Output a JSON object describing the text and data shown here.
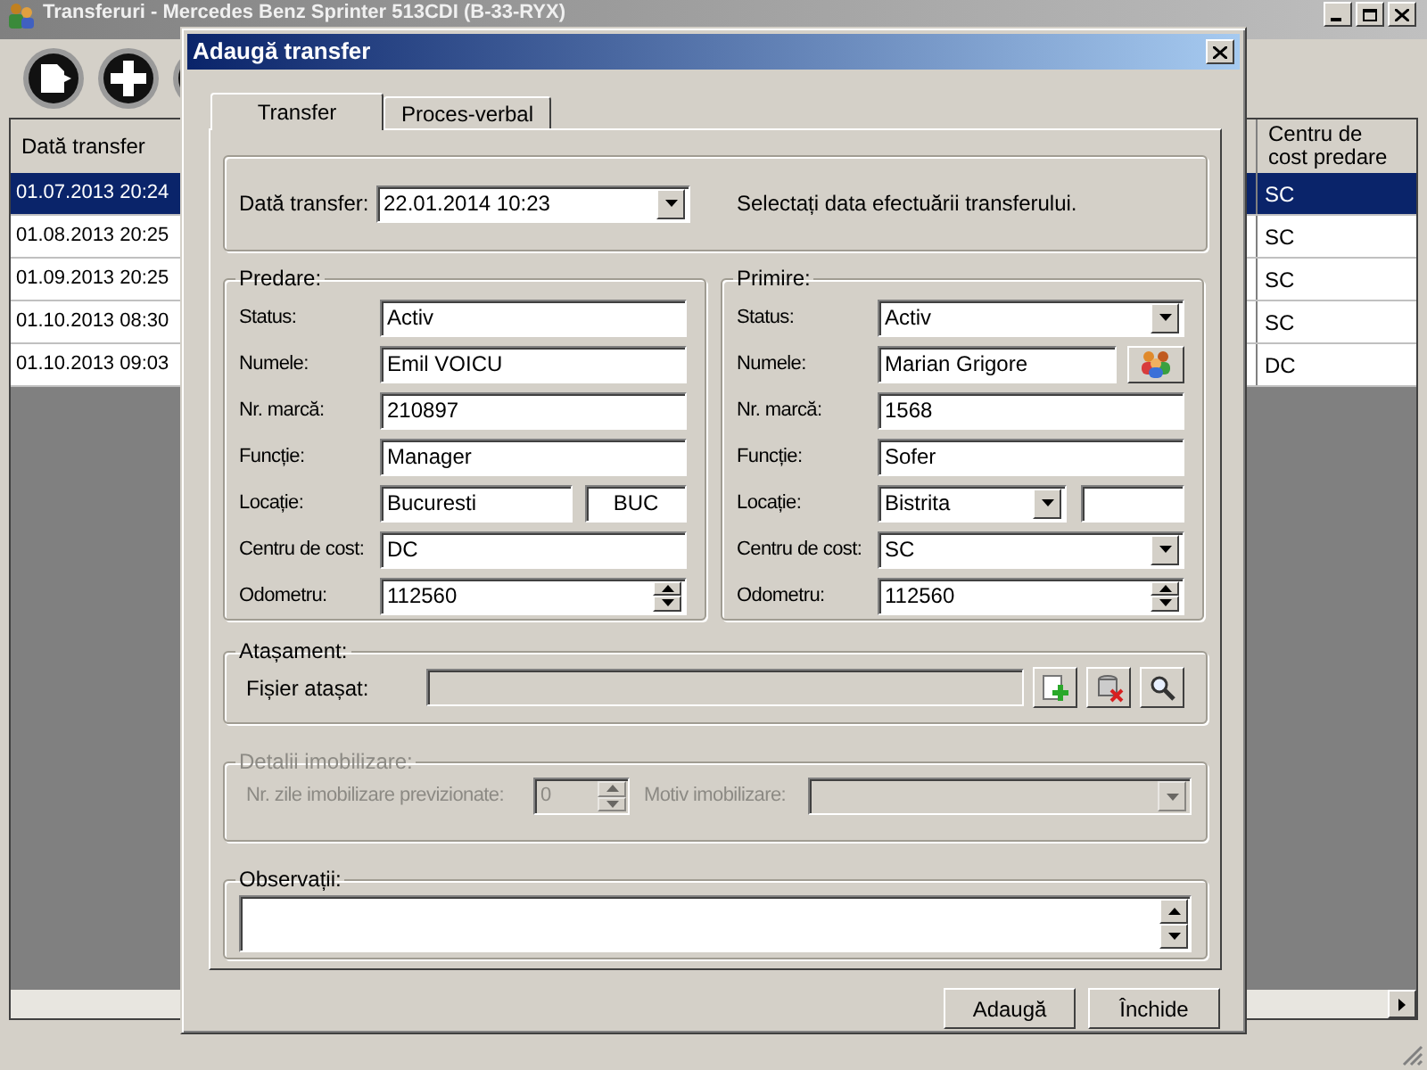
{
  "main_window": {
    "title": "Transferuri - Mercedes Benz Sprinter 513CDI (B-33-RYX)"
  },
  "table": {
    "columns": [
      "Dată transfer",
      "Centru de cost predare"
    ],
    "rows": [
      {
        "cells": [
          "01.07.2013 20:24",
          "SC"
        ],
        "selected": true
      },
      {
        "cells": [
          "01.08.2013 20:25",
          "SC"
        ],
        "selected": false
      },
      {
        "cells": [
          "01.09.2013 20:25",
          "SC"
        ],
        "selected": false
      },
      {
        "cells": [
          "01.10.2013 08:30",
          "SC"
        ],
        "selected": false
      },
      {
        "cells": [
          "01.10.2013 09:03",
          "DC"
        ],
        "selected": false
      }
    ]
  },
  "dialog": {
    "title": "Adaugă transfer",
    "tabs": [
      {
        "label": "Transfer",
        "selected": true
      },
      {
        "label": "Proces-verbal",
        "selected": false
      }
    ],
    "date": {
      "label": "Dată transfer:",
      "value": "22.01.2014 10:23",
      "hint": "Selectați data efectuării transferului."
    },
    "groups": [
      {
        "legend": "Predare:",
        "fields": [
          {
            "label": "Status:",
            "value": "Activ",
            "kind": "text"
          },
          {
            "label": "Numele:",
            "value": "Emil VOICU",
            "kind": "text"
          },
          {
            "label": "Nr. marcă:",
            "value": "210897",
            "kind": "text"
          },
          {
            "label": "Funcție:",
            "value": "Manager",
            "kind": "text"
          },
          {
            "label": "Locație:",
            "value": "Bucuresti",
            "code": "BUC",
            "kind": "text_code"
          },
          {
            "label": "Centru de cost:",
            "value": "DC",
            "kind": "text"
          },
          {
            "label": "Odometru:",
            "value": "112560",
            "kind": "spin"
          }
        ]
      },
      {
        "legend": "Primire:",
        "fields": [
          {
            "label": "Status:",
            "value": "Activ",
            "kind": "combo"
          },
          {
            "label": "Numele:",
            "value": "Marian Grigore",
            "kind": "lookup"
          },
          {
            "label": "Nr. marcă:",
            "value": "1568",
            "kind": "text"
          },
          {
            "label": "Funcție:",
            "value": "Sofer",
            "kind": "text"
          },
          {
            "label": "Locație:",
            "value": "Bistrita",
            "kind": "combo_box"
          },
          {
            "label": "Centru de cost:",
            "value": "SC",
            "kind": "combo"
          },
          {
            "label": "Odometru:",
            "value": "112560",
            "kind": "spin"
          }
        ]
      }
    ],
    "attachment": {
      "legend": "Atașament:",
      "label": "Fișier atașat:"
    },
    "immobilization": {
      "legend": "Detalii imobilizare:",
      "disabled": true,
      "days_label": "Nr. zile imobilizare previzionate:",
      "days_value": "0",
      "reason_label": "Motiv imobilizare:"
    },
    "notes": {
      "legend": "Observații:"
    },
    "buttons": [
      "Adaugă",
      "Închide"
    ]
  }
}
